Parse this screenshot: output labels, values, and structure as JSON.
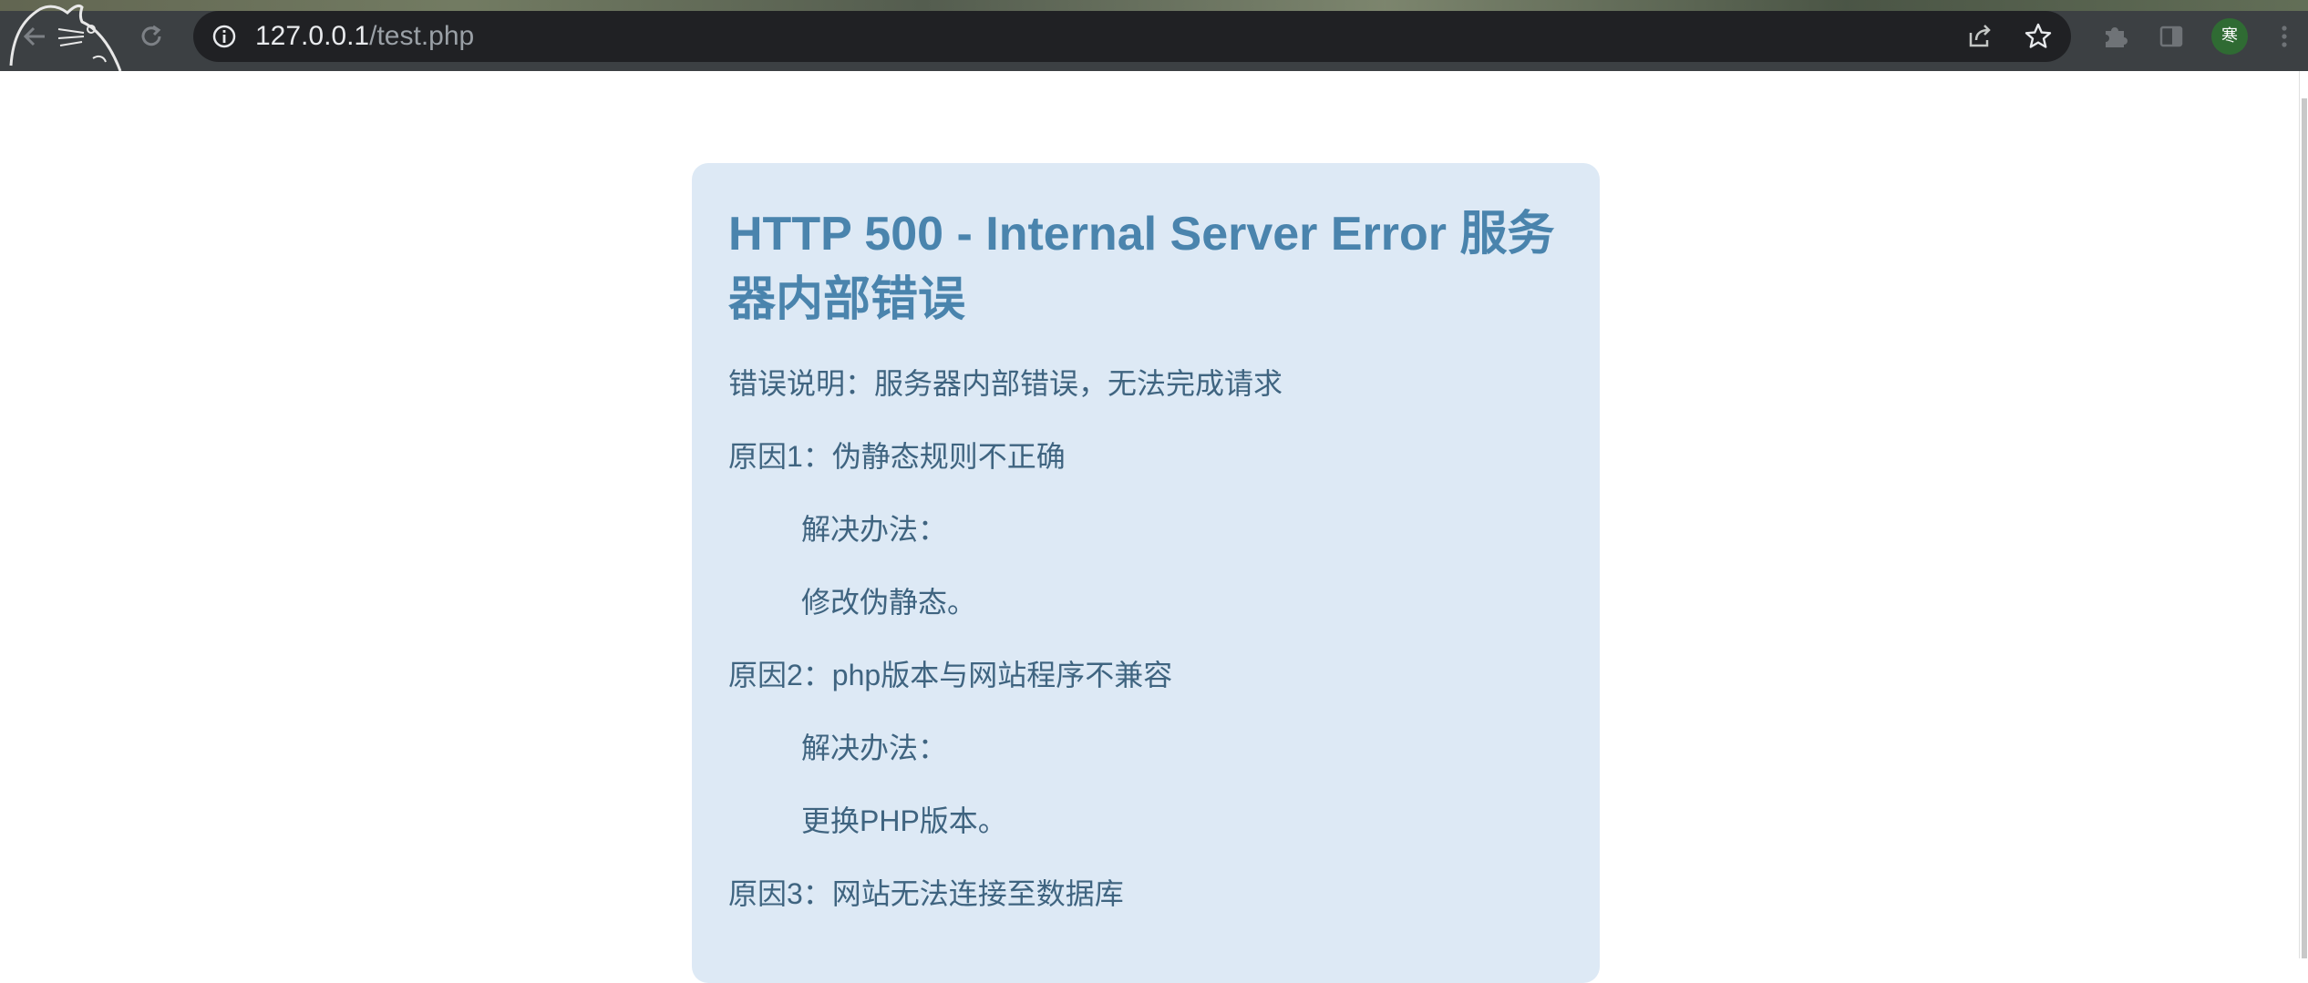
{
  "browser": {
    "url_host": "127.0.0.1",
    "url_path": "/test.php",
    "profile_initial": "寒",
    "icons": {
      "back": "back-arrow-icon",
      "reload": "reload-icon",
      "site_info": "info-icon",
      "share": "share-icon",
      "bookmark": "star-icon",
      "extensions": "puzzle-icon",
      "side_panel": "side-panel-icon",
      "menu": "kebab-menu-icon"
    }
  },
  "error": {
    "title": "HTTP 500 - Internal Server Error 服务器内部错误",
    "description": "错误说明：服务器内部错误，无法完成请求",
    "reason1": "原因1：伪静态规则不正确",
    "solution1_label": "解决办法：",
    "solution1_text": "修改伪静态。",
    "reason2": "原因2：php版本与网站程序不兼容",
    "solution2_label": "解决办法：",
    "solution2_text": "更换PHP版本。",
    "reason3": "原因3：网站无法连接至数据库"
  },
  "colors": {
    "card_bg": "#dde9f5",
    "title": "#4a84ad",
    "body_text": "#3f6480",
    "chrome_bg": "#3c4043",
    "omnibox_bg": "#202124",
    "avatar_bg": "#2f6b33"
  }
}
